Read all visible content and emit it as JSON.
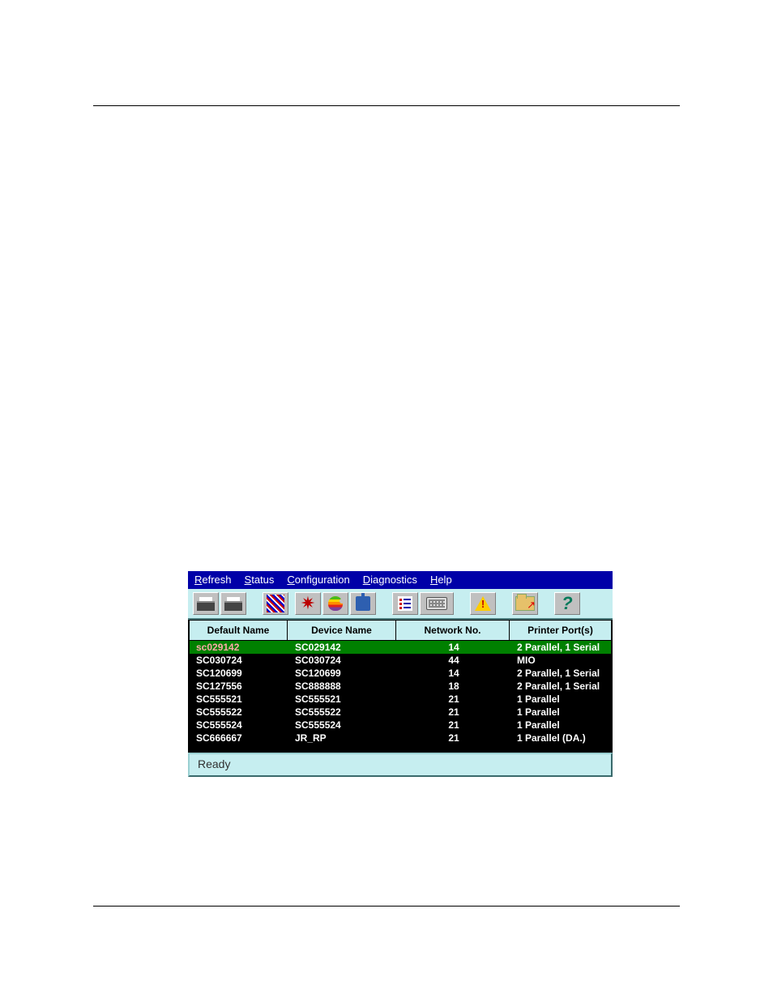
{
  "menu": {
    "refresh": "Refresh",
    "status": "Status",
    "configuration": "Configuration",
    "diagnostics": "Diagnostics",
    "help": "Help"
  },
  "columns": {
    "default_name": "Default Name",
    "device_name": "Device Name",
    "network_no": "Network No.",
    "printer_ports": "Printer Port(s)"
  },
  "rows": [
    {
      "default_name": "sc029142",
      "device_name": "SC029142",
      "network_no": "14",
      "ports": "2 Parallel, 1 Serial",
      "selected": true
    },
    {
      "default_name": "SC030724",
      "device_name": "SC030724",
      "network_no": "44",
      "ports": "MIO"
    },
    {
      "default_name": "SC120699",
      "device_name": "SC120699",
      "network_no": "14",
      "ports": "2 Parallel, 1 Serial"
    },
    {
      "default_name": "SC127556",
      "device_name": "SC888888",
      "network_no": "18",
      "ports": "2 Parallel, 1 Serial"
    },
    {
      "default_name": "SC555521",
      "device_name": "SC555521",
      "network_no": "21",
      "ports": "1 Parallel"
    },
    {
      "default_name": "SC555522",
      "device_name": "SC555522",
      "network_no": "21",
      "ports": "1 Parallel"
    },
    {
      "default_name": "SC555524",
      "device_name": "SC555524",
      "network_no": "21",
      "ports": "1 Parallel"
    },
    {
      "default_name": "SC666667",
      "device_name": "JR_RP",
      "network_no": "21",
      "ports": "1 Parallel (DA.)"
    }
  ],
  "status_text": "Ready",
  "icons": {
    "tb_connect": "connect-icon",
    "tb_print": "print-icon",
    "tb_network": "network-icon",
    "tb_novell": "novell-icon",
    "tb_apple": "apple-icon",
    "tb_lanman": "lanman-icon",
    "tb_list": "list-icon",
    "tb_keyboard": "keyboard-icon",
    "tb_warn": "diagnostics-icon",
    "tb_folder": "open-folder-icon",
    "tb_help": "help-icon"
  }
}
